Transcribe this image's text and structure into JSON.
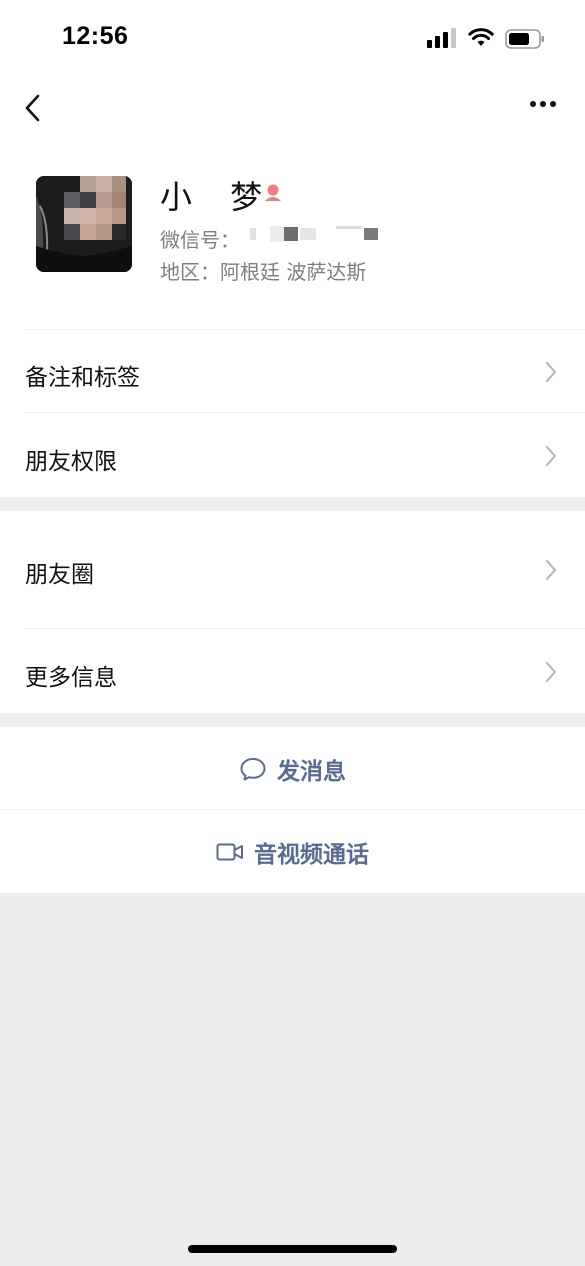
{
  "status_bar": {
    "time": "12:56"
  },
  "profile": {
    "name": "小 梦",
    "wechat_id_label": "微信号：",
    "region_label": "地区：",
    "region_value": "阿根廷 波萨达斯"
  },
  "menu": {
    "remarks_tags": "备注和标签",
    "friend_permissions": "朋友权限",
    "moments": "朋友圈",
    "more_info": "更多信息"
  },
  "actions": {
    "send_message": "发消息",
    "video_call": "音视频通话"
  },
  "colors": {
    "link_blue": "#576b95",
    "page_bg": "#ededed",
    "secondary_text": "#7f7f7f"
  }
}
